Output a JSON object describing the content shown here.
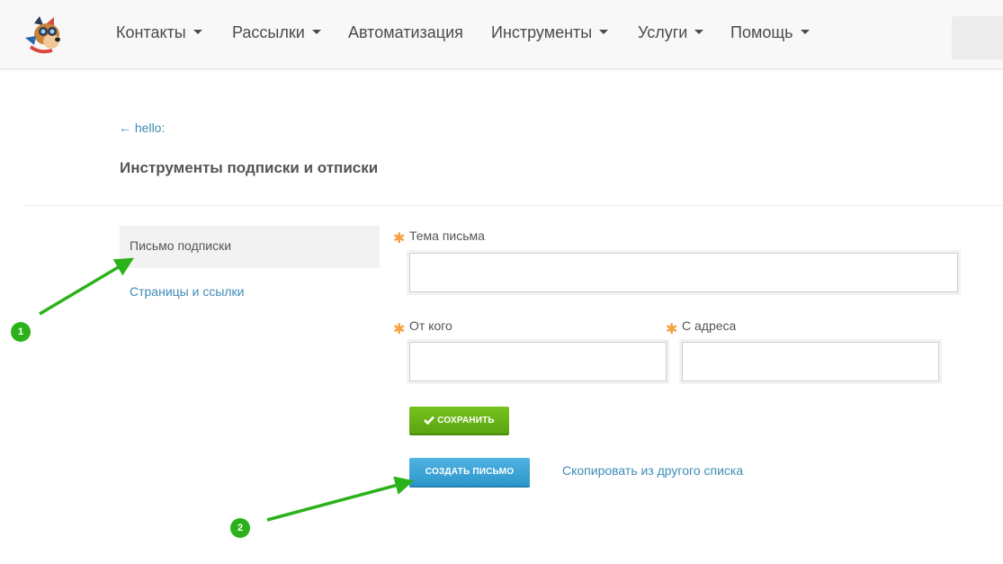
{
  "nav": {
    "items": [
      {
        "label": "Контакты",
        "dropdown": true
      },
      {
        "label": "Рассылки",
        "dropdown": true
      },
      {
        "label": "Автоматизация",
        "dropdown": false
      },
      {
        "label": "Инструменты",
        "dropdown": true
      },
      {
        "label": "Услуги",
        "dropdown": true
      },
      {
        "label": "Помощь",
        "dropdown": true
      }
    ]
  },
  "header": {
    "back_link": "← hello:",
    "title": "Инструменты подписки и отписки"
  },
  "sidebar": {
    "items": [
      {
        "label": "Письмо подписки",
        "active": true
      },
      {
        "label": "Страницы и ссылки",
        "active": false
      }
    ]
  },
  "form": {
    "subject": {
      "label": "Тема письма",
      "value": "",
      "required": true
    },
    "from_name": {
      "label": "От кого",
      "value": "",
      "required": true
    },
    "from_address": {
      "label": "С адреса",
      "value": "",
      "required": true
    },
    "required_mark": "✱",
    "save_label": "СОХРАНИТЬ",
    "create_label": "СОЗДАТЬ ПИСЬМО",
    "copy_link": "Скопировать из другого списка"
  },
  "annotations": {
    "badge_1": "1",
    "badge_2": "2"
  },
  "colors": {
    "accent_link": "#3d8cb5",
    "save_button": "#6ab61a",
    "create_button": "#3aa5d8",
    "required": "#f5a041",
    "annotation": "#2bb21a"
  }
}
